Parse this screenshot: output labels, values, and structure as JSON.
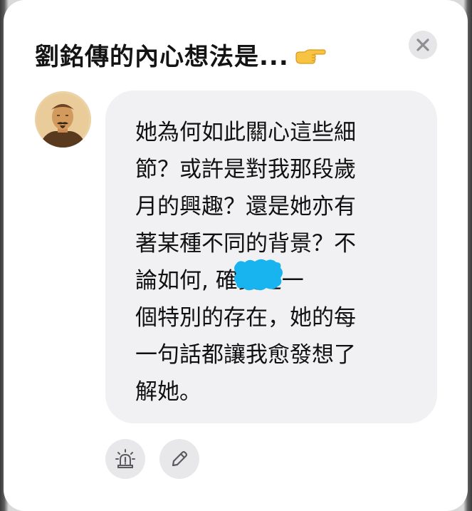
{
  "dialog": {
    "title": "劉銘傳的內心想法是...",
    "title_emoji": "👉"
  },
  "message": {
    "text": "她為何如此關心這些細\n節？或許是對我那段歲\n月的興趣？還是她亦有\n著某種不同的背景？不\n論如何,             確實是一\n個特別的存在，她的每\n一句話都讓我愈發想了\n解她。"
  },
  "icons": {
    "close": "close-icon",
    "avatar": "portrait-avatar",
    "alarm": "alarm-light-icon",
    "edit": "pencil-icon"
  },
  "colors": {
    "bubble": "#f1f1f3",
    "redaction": "#18b4f0",
    "button": "#e8e8ea"
  }
}
